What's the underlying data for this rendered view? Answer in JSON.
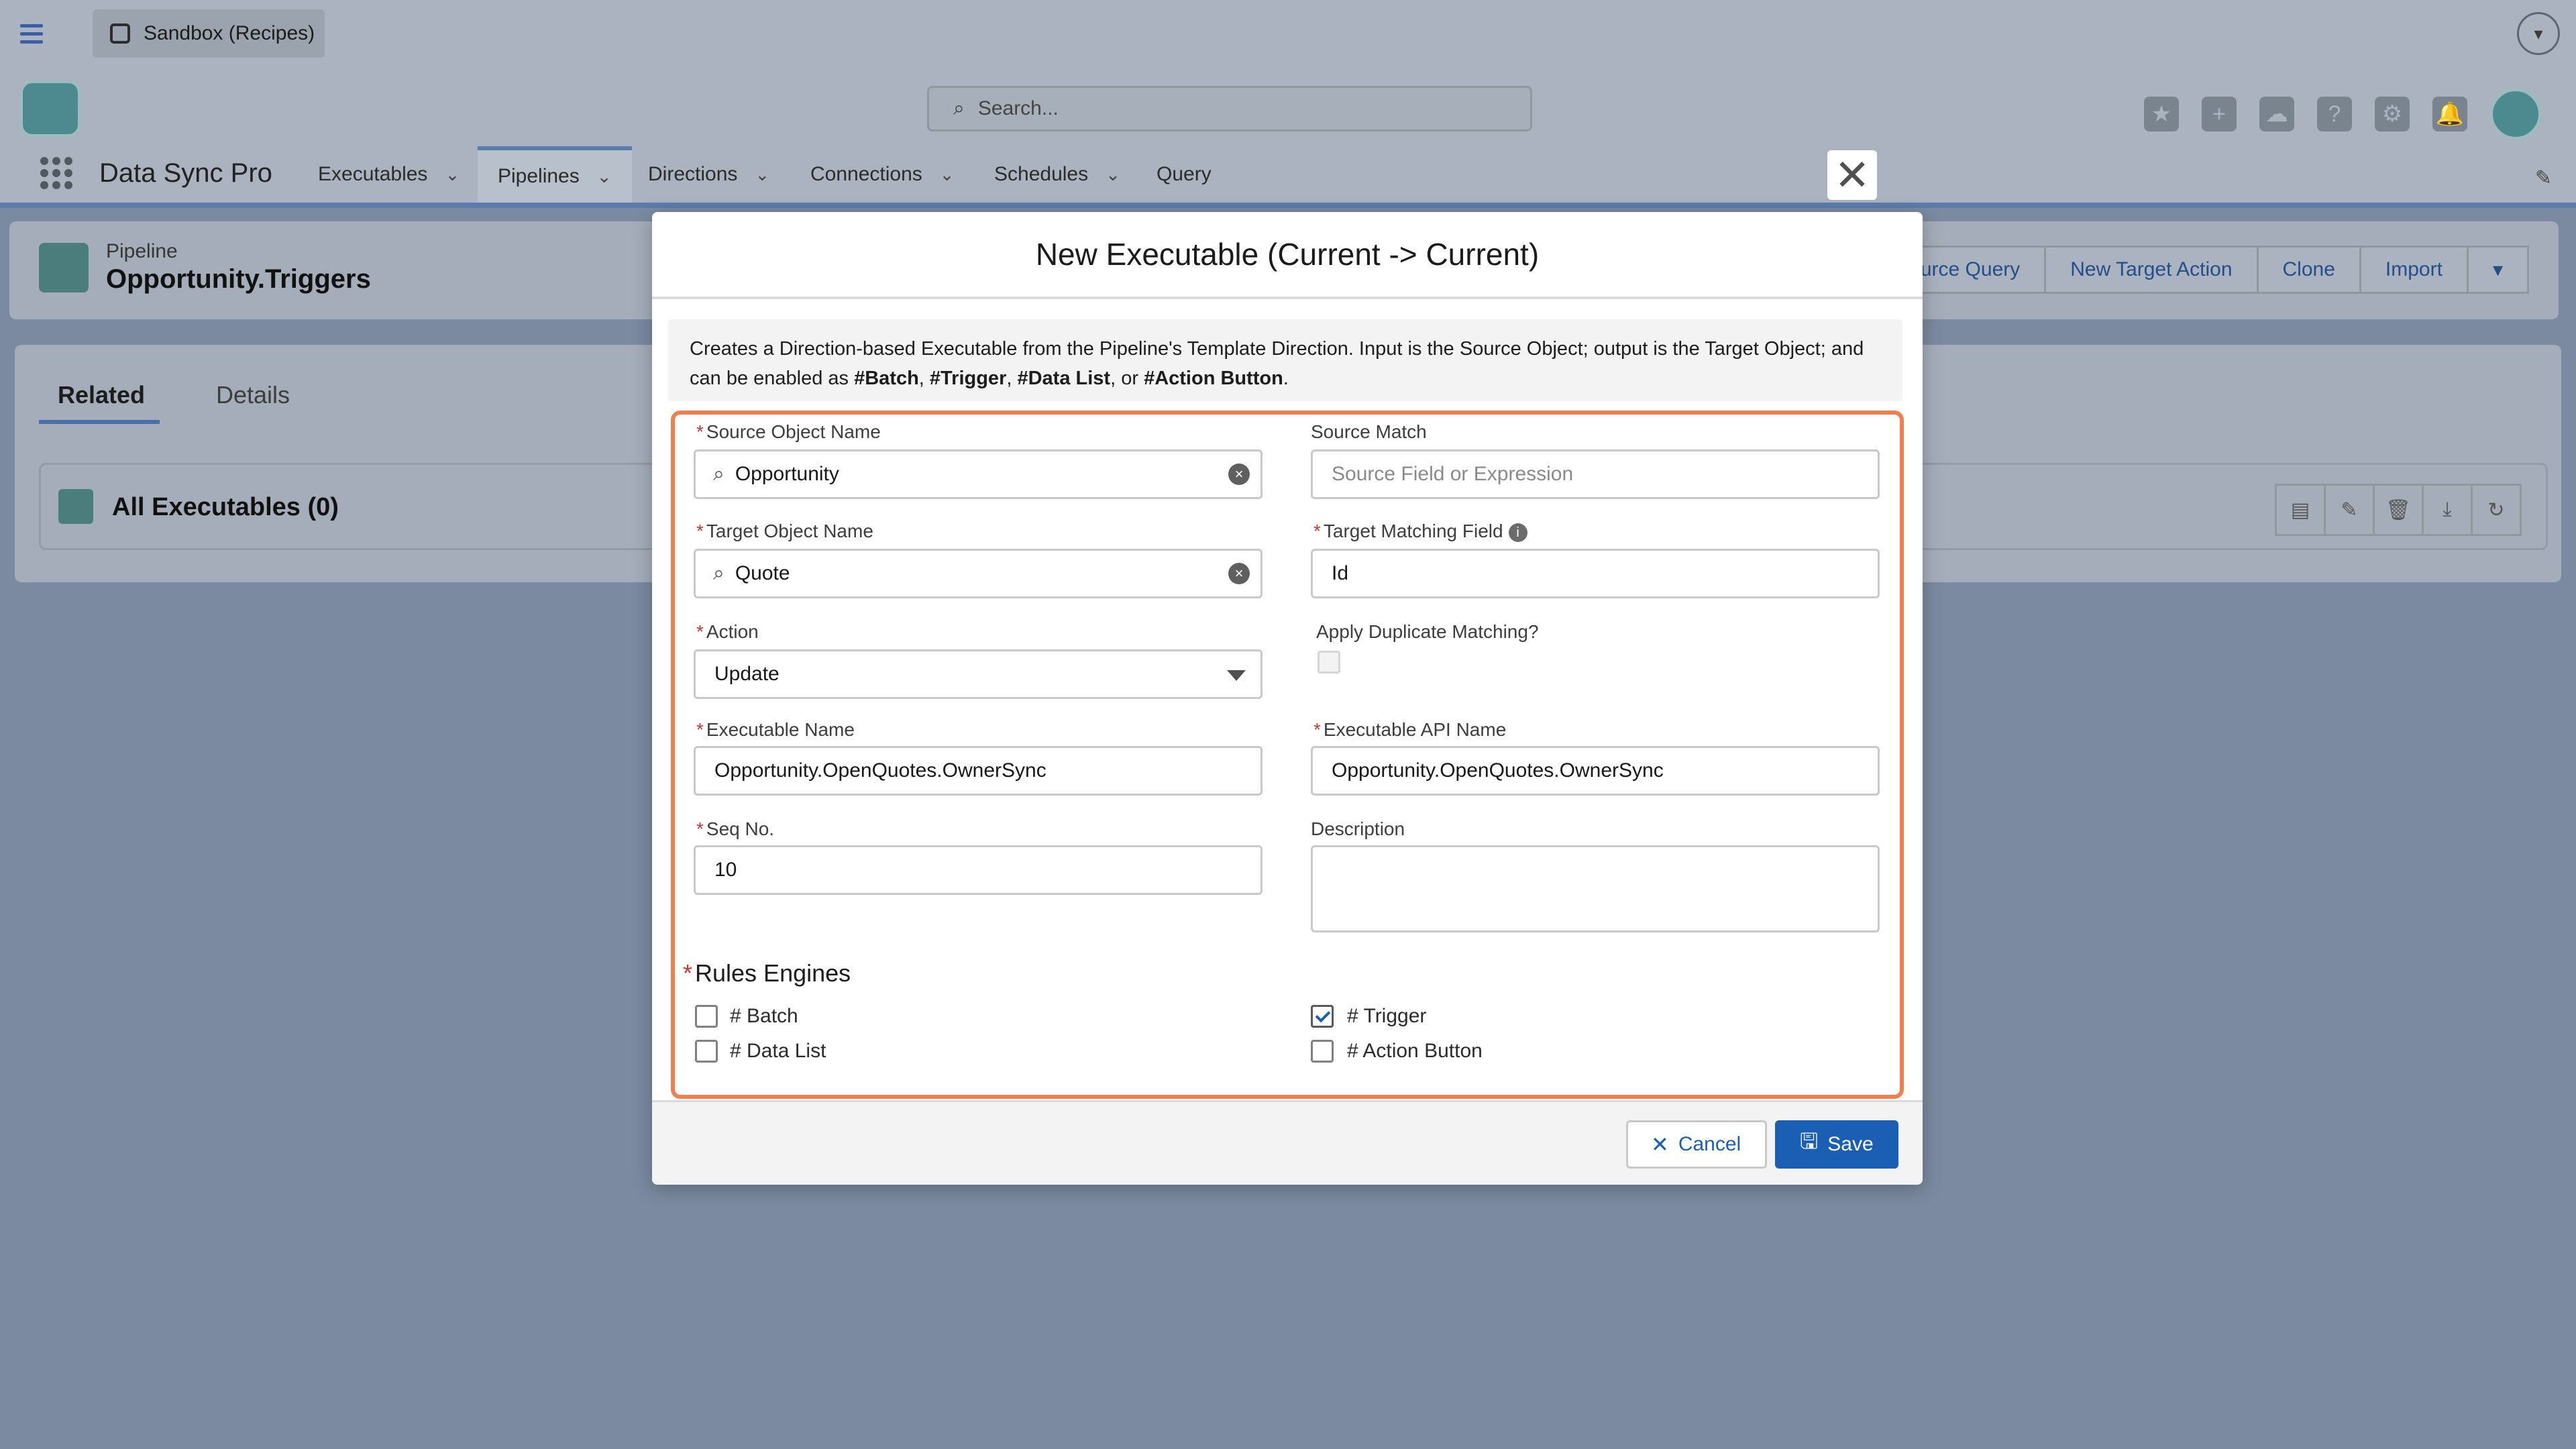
{
  "app": {
    "sandbox_label": "Sandbox (Recipes)",
    "name": "Data Sync Pro",
    "search_placeholder": "Search..."
  },
  "nav": {
    "items": [
      {
        "label": "Executables",
        "has_menu": true
      },
      {
        "label": "Pipelines",
        "has_menu": true,
        "active": true
      },
      {
        "label": "Directions",
        "has_menu": true
      },
      {
        "label": "Connections",
        "has_menu": true
      },
      {
        "label": "Schedules",
        "has_menu": true
      },
      {
        "label": "Query",
        "has_menu": false
      }
    ]
  },
  "record": {
    "type": "Pipeline",
    "title": "Opportunity.Triggers",
    "actions": [
      "Source Query",
      "New Target Action",
      "Clone",
      "Import"
    ]
  },
  "tabs": {
    "related": "Related",
    "details": "Details"
  },
  "related_list": {
    "title": "All Executables (0)"
  },
  "modal": {
    "title": "New Executable (Current -> Current)",
    "info": {
      "p1": "Creates a Direction-based Executable from the Pipeline's Template Direction. Input is the Source Object; output is the Target Object; and can be enabled as ",
      "batch": "#Batch",
      "sep1": ", ",
      "trigger": "#Trigger",
      "sep2": ", ",
      "datalist": "#Data List",
      "sep3": ", or ",
      "action": "#Action Button",
      "end": "."
    },
    "fields": {
      "source_object_label": "Source Object Name",
      "source_object_value": "Opportunity",
      "source_match_label": "Source Match",
      "source_match_placeholder": "Source Field or Expression",
      "target_object_label": "Target Object Name",
      "target_object_value": "Quote",
      "target_match_label": "Target Matching Field",
      "target_match_value": "Id",
      "action_label": "Action",
      "action_value": "Update",
      "apply_dup_label": "Apply Duplicate Matching?",
      "exec_name_label": "Executable Name",
      "exec_name_value": "Opportunity.OpenQuotes.OwnerSync",
      "exec_api_label": "Executable API Name",
      "exec_api_value": "Opportunity.OpenQuotes.OwnerSync",
      "seq_label": "Seq No.",
      "seq_value": "10",
      "desc_label": "Description"
    },
    "rules": {
      "title": "Rules Engines",
      "batch": {
        "label": "# Batch",
        "checked": false
      },
      "trigger": {
        "label": "# Trigger",
        "checked": true
      },
      "datalist": {
        "label": "# Data List",
        "checked": false
      },
      "action_button": {
        "label": "# Action Button",
        "checked": false
      }
    },
    "cancel_label": "Cancel",
    "save_label": "Save",
    "required_mark": "*",
    "close_glyph": "✕"
  },
  "colors": {
    "brand_blue": "#1b5fb5",
    "highlight_orange": "#f07f4f",
    "required_red": "#c23934"
  }
}
